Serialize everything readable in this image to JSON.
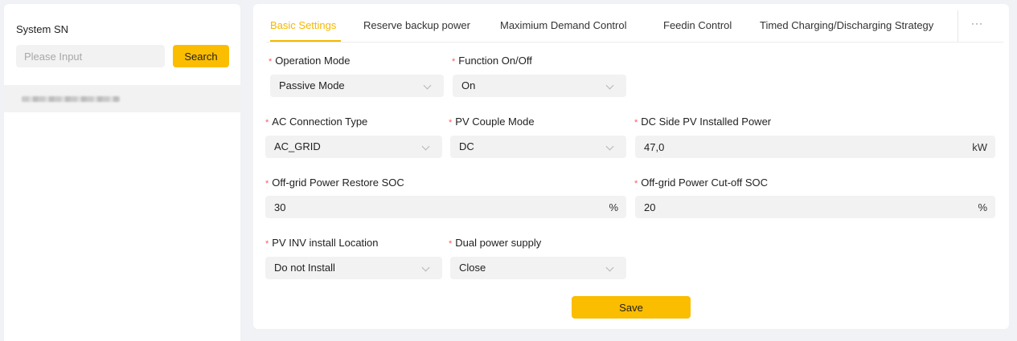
{
  "sidebar": {
    "sn_label": "System SN",
    "sn_placeholder": "Please Input",
    "search_label": "Search"
  },
  "tabs": [
    {
      "label": "Basic Settings",
      "active": true
    },
    {
      "label": "Reserve backup power",
      "active": false
    },
    {
      "label": "Maximium Demand Control",
      "active": false
    },
    {
      "label": "Feedin Control",
      "active": false
    },
    {
      "label": "Timed Charging/Discharging Strategy",
      "active": false
    }
  ],
  "tabs_more": "···",
  "form": {
    "required_mark": "*",
    "operation_mode": {
      "label": "Operation Mode",
      "value": "Passive Mode"
    },
    "function_onoff": {
      "label": "Function On/Off",
      "value": "On"
    },
    "ac_connection_type": {
      "label": "AC Connection Type",
      "value": "AC_GRID"
    },
    "pv_couple_mode": {
      "label": "PV Couple Mode",
      "value": "DC"
    },
    "dc_pv_power": {
      "label": "DC Side PV Installed Power",
      "value": "47,0",
      "unit": "kW"
    },
    "restore_soc": {
      "label": "Off-grid Power Restore SOC",
      "value": "30",
      "unit": "%"
    },
    "cutoff_soc": {
      "label": "Off-grid Power Cut-off SOC",
      "value": "20",
      "unit": "%"
    },
    "pv_inv_location": {
      "label": "PV INV install Location",
      "value": "Do not Install"
    },
    "dual_power_supply": {
      "label": "Dual power supply",
      "value": "Close"
    },
    "save_label": "Save"
  },
  "colors": {
    "accent": "#fabd00",
    "required": "#ff5a5a",
    "field_bg": "#f2f2f2",
    "page_bg": "#f0f2f5"
  }
}
